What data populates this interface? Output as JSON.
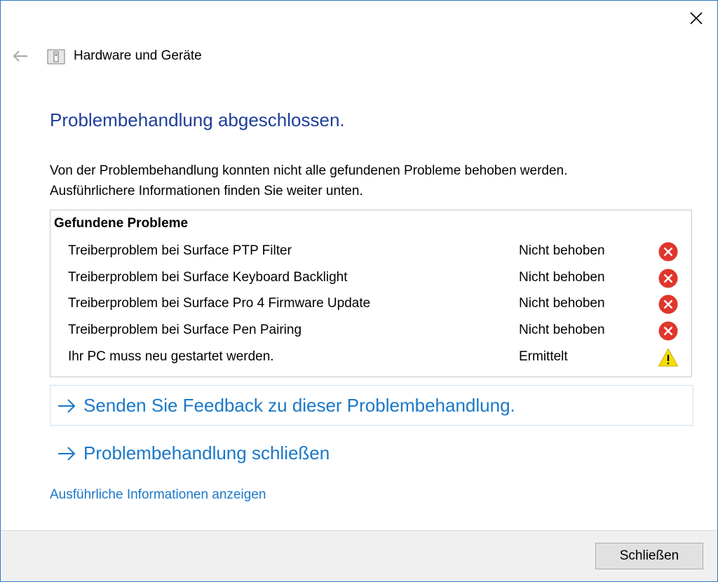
{
  "window": {
    "title": "Hardware und Geräte",
    "icons": {
      "back": "back-arrow-icon",
      "app": "troubleshooter-icon",
      "close": "close-icon"
    }
  },
  "main": {
    "heading": "Problembehandlung abgeschlossen.",
    "description_line1": "Von der Problembehandlung konnten nicht alle gefundenen Probleme behoben werden.",
    "description_line2": "Ausführlichere Informationen finden Sie weiter unten."
  },
  "problems": {
    "title": "Gefundene Probleme",
    "rows": [
      {
        "name": "Treiberproblem bei Surface PTP Filter",
        "status": "Nicht behoben",
        "icon": "error-icon"
      },
      {
        "name": "Treiberproblem bei Surface Keyboard Backlight",
        "status": "Nicht behoben",
        "icon": "error-icon"
      },
      {
        "name": "Treiberproblem bei Surface Pro 4 Firmware Update",
        "status": "Nicht behoben",
        "icon": "error-icon"
      },
      {
        "name": "Treiberproblem bei Surface Pen Pairing",
        "status": "Nicht behoben",
        "icon": "error-icon"
      },
      {
        "name": "Ihr PC muss neu gestartet werden.",
        "status": "Ermittelt",
        "icon": "warning-icon"
      }
    ]
  },
  "links": {
    "feedback": "Senden Sie Feedback zu dieser Problembehandlung.",
    "close_troubleshooter": "Problembehandlung schließen",
    "details": "Ausführliche Informationen anzeigen"
  },
  "footer": {
    "close_button": "Schließen"
  },
  "colors": {
    "heading": "#1f3f9a",
    "link": "#1a78c8",
    "error": "#e0362c",
    "warning": "#f7e000",
    "window_border": "#2b78c5"
  }
}
